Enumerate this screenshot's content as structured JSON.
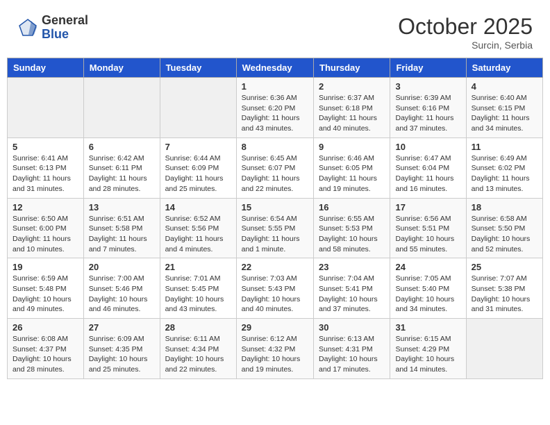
{
  "header": {
    "logo_general": "General",
    "logo_blue": "Blue",
    "month": "October 2025",
    "location": "Surcin, Serbia"
  },
  "weekdays": [
    "Sunday",
    "Monday",
    "Tuesday",
    "Wednesday",
    "Thursday",
    "Friday",
    "Saturday"
  ],
  "weeks": [
    [
      {
        "day": "",
        "info": ""
      },
      {
        "day": "",
        "info": ""
      },
      {
        "day": "",
        "info": ""
      },
      {
        "day": "1",
        "info": "Sunrise: 6:36 AM\nSunset: 6:20 PM\nDaylight: 11 hours\nand 43 minutes."
      },
      {
        "day": "2",
        "info": "Sunrise: 6:37 AM\nSunset: 6:18 PM\nDaylight: 11 hours\nand 40 minutes."
      },
      {
        "day": "3",
        "info": "Sunrise: 6:39 AM\nSunset: 6:16 PM\nDaylight: 11 hours\nand 37 minutes."
      },
      {
        "day": "4",
        "info": "Sunrise: 6:40 AM\nSunset: 6:15 PM\nDaylight: 11 hours\nand 34 minutes."
      }
    ],
    [
      {
        "day": "5",
        "info": "Sunrise: 6:41 AM\nSunset: 6:13 PM\nDaylight: 11 hours\nand 31 minutes."
      },
      {
        "day": "6",
        "info": "Sunrise: 6:42 AM\nSunset: 6:11 PM\nDaylight: 11 hours\nand 28 minutes."
      },
      {
        "day": "7",
        "info": "Sunrise: 6:44 AM\nSunset: 6:09 PM\nDaylight: 11 hours\nand 25 minutes."
      },
      {
        "day": "8",
        "info": "Sunrise: 6:45 AM\nSunset: 6:07 PM\nDaylight: 11 hours\nand 22 minutes."
      },
      {
        "day": "9",
        "info": "Sunrise: 6:46 AM\nSunset: 6:05 PM\nDaylight: 11 hours\nand 19 minutes."
      },
      {
        "day": "10",
        "info": "Sunrise: 6:47 AM\nSunset: 6:04 PM\nDaylight: 11 hours\nand 16 minutes."
      },
      {
        "day": "11",
        "info": "Sunrise: 6:49 AM\nSunset: 6:02 PM\nDaylight: 11 hours\nand 13 minutes."
      }
    ],
    [
      {
        "day": "12",
        "info": "Sunrise: 6:50 AM\nSunset: 6:00 PM\nDaylight: 11 hours\nand 10 minutes."
      },
      {
        "day": "13",
        "info": "Sunrise: 6:51 AM\nSunset: 5:58 PM\nDaylight: 11 hours\nand 7 minutes."
      },
      {
        "day": "14",
        "info": "Sunrise: 6:52 AM\nSunset: 5:56 PM\nDaylight: 11 hours\nand 4 minutes."
      },
      {
        "day": "15",
        "info": "Sunrise: 6:54 AM\nSunset: 5:55 PM\nDaylight: 11 hours\nand 1 minute."
      },
      {
        "day": "16",
        "info": "Sunrise: 6:55 AM\nSunset: 5:53 PM\nDaylight: 10 hours\nand 58 minutes."
      },
      {
        "day": "17",
        "info": "Sunrise: 6:56 AM\nSunset: 5:51 PM\nDaylight: 10 hours\nand 55 minutes."
      },
      {
        "day": "18",
        "info": "Sunrise: 6:58 AM\nSunset: 5:50 PM\nDaylight: 10 hours\nand 52 minutes."
      }
    ],
    [
      {
        "day": "19",
        "info": "Sunrise: 6:59 AM\nSunset: 5:48 PM\nDaylight: 10 hours\nand 49 minutes."
      },
      {
        "day": "20",
        "info": "Sunrise: 7:00 AM\nSunset: 5:46 PM\nDaylight: 10 hours\nand 46 minutes."
      },
      {
        "day": "21",
        "info": "Sunrise: 7:01 AM\nSunset: 5:45 PM\nDaylight: 10 hours\nand 43 minutes."
      },
      {
        "day": "22",
        "info": "Sunrise: 7:03 AM\nSunset: 5:43 PM\nDaylight: 10 hours\nand 40 minutes."
      },
      {
        "day": "23",
        "info": "Sunrise: 7:04 AM\nSunset: 5:41 PM\nDaylight: 10 hours\nand 37 minutes."
      },
      {
        "day": "24",
        "info": "Sunrise: 7:05 AM\nSunset: 5:40 PM\nDaylight: 10 hours\nand 34 minutes."
      },
      {
        "day": "25",
        "info": "Sunrise: 7:07 AM\nSunset: 5:38 PM\nDaylight: 10 hours\nand 31 minutes."
      }
    ],
    [
      {
        "day": "26",
        "info": "Sunrise: 6:08 AM\nSunset: 4:37 PM\nDaylight: 10 hours\nand 28 minutes."
      },
      {
        "day": "27",
        "info": "Sunrise: 6:09 AM\nSunset: 4:35 PM\nDaylight: 10 hours\nand 25 minutes."
      },
      {
        "day": "28",
        "info": "Sunrise: 6:11 AM\nSunset: 4:34 PM\nDaylight: 10 hours\nand 22 minutes."
      },
      {
        "day": "29",
        "info": "Sunrise: 6:12 AM\nSunset: 4:32 PM\nDaylight: 10 hours\nand 19 minutes."
      },
      {
        "day": "30",
        "info": "Sunrise: 6:13 AM\nSunset: 4:31 PM\nDaylight: 10 hours\nand 17 minutes."
      },
      {
        "day": "31",
        "info": "Sunrise: 6:15 AM\nSunset: 4:29 PM\nDaylight: 10 hours\nand 14 minutes."
      },
      {
        "day": "",
        "info": ""
      }
    ]
  ]
}
